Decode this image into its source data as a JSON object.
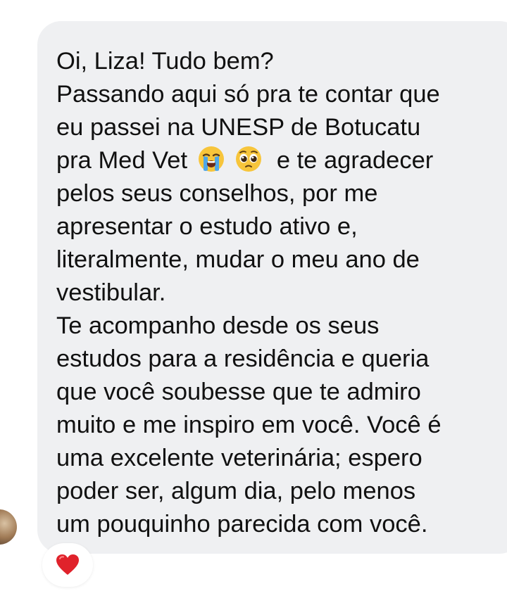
{
  "message": {
    "lines": [
      "Oi, Liza! Tudo bem?",
      "Passando aqui só pra te contar que",
      "eu passei na UNESP de Botucatu",
      "pra Med Vet",
      "e te agradecer",
      "pelos seus conselhos, por me",
      "apresentar o estudo ativo e,",
      "literalmente, mudar o meu ano de",
      "vestibular.",
      "Te acompanho desde os seus",
      "estudos para a residência e queria",
      "que você soubesse que te admiro",
      "muito e me inspiro em você. Você é",
      "uma excelente veterinária; espero",
      "poder ser, algum dia, pelo menos",
      "um pouquinho parecida com você."
    ],
    "emojis": [
      "loudly-crying-face-icon",
      "pleading-face-icon"
    ],
    "highlight_color": "#fbe6a6",
    "bubble_color": "#eff0f2",
    "text_color": "#111111"
  },
  "reaction": {
    "icon": "red-heart-icon",
    "color": "#e0222b"
  }
}
